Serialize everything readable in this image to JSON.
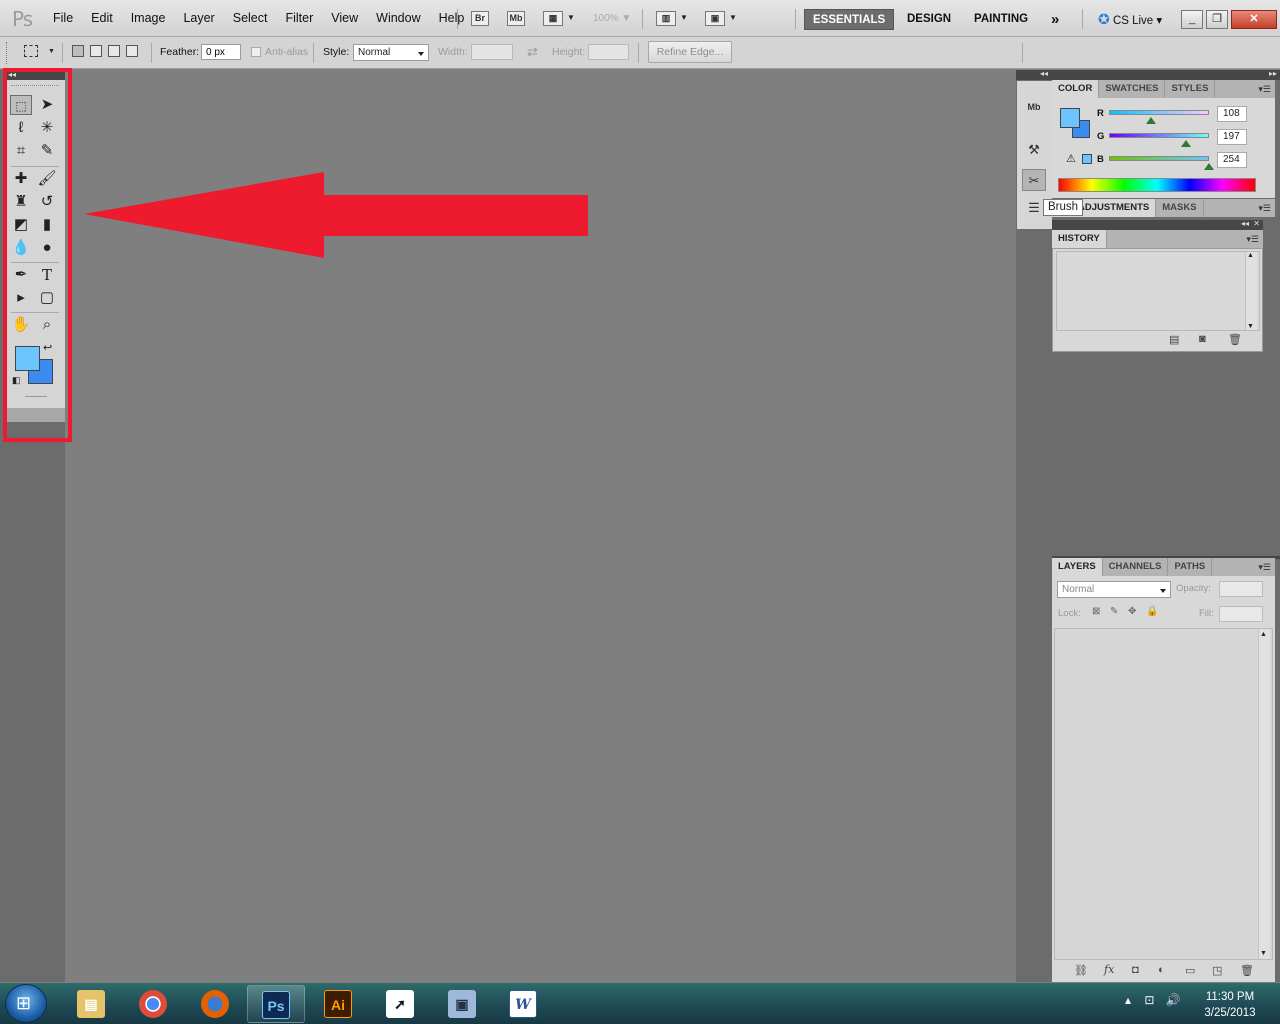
{
  "app": {
    "logo": "Ps"
  },
  "menu": [
    "File",
    "Edit",
    "Image",
    "Layer",
    "Select",
    "Filter",
    "View",
    "Window",
    "Help"
  ],
  "menu_buttons": {
    "bridge": "Br",
    "mini_bridge": "Mb",
    "zoom": "100%"
  },
  "workspaces": {
    "essentials": "ESSENTIALS",
    "design": "DESIGN",
    "painting": "PAINTING",
    "more": "»",
    "cslive": "CS Live"
  },
  "options": {
    "feather_label": "Feather:",
    "feather_value": "0 px",
    "antialias_label": "Anti-alias",
    "style_label": "Style:",
    "style_value": "Normal",
    "width_label": "Width:",
    "height_label": "Height:",
    "refine_edge": "Refine Edge..."
  },
  "colors": {
    "foreground": "#6cc5fe",
    "background": "#3a8cf0",
    "arrow": "#ee1b2e"
  },
  "color_panel": {
    "tabs": [
      "COLOR",
      "SWATCHES",
      "STYLES"
    ],
    "r_label": "R",
    "g_label": "G",
    "b_label": "B",
    "r_value": "108",
    "g_value": "197",
    "b_value": "254"
  },
  "tooltip": "Brush",
  "adjust_tabs": [
    "ADJUSTMENTS",
    "MASKS"
  ],
  "history": {
    "tab": "HISTORY"
  },
  "layers": {
    "tabs": [
      "LAYERS",
      "CHANNELS",
      "PATHS"
    ],
    "blend": "Normal",
    "opacity_label": "Opacity:",
    "lock_label": "Lock:",
    "fill_label": "Fill:"
  },
  "taskbar": {
    "time": "11:30 PM",
    "date": "3/25/2013"
  }
}
